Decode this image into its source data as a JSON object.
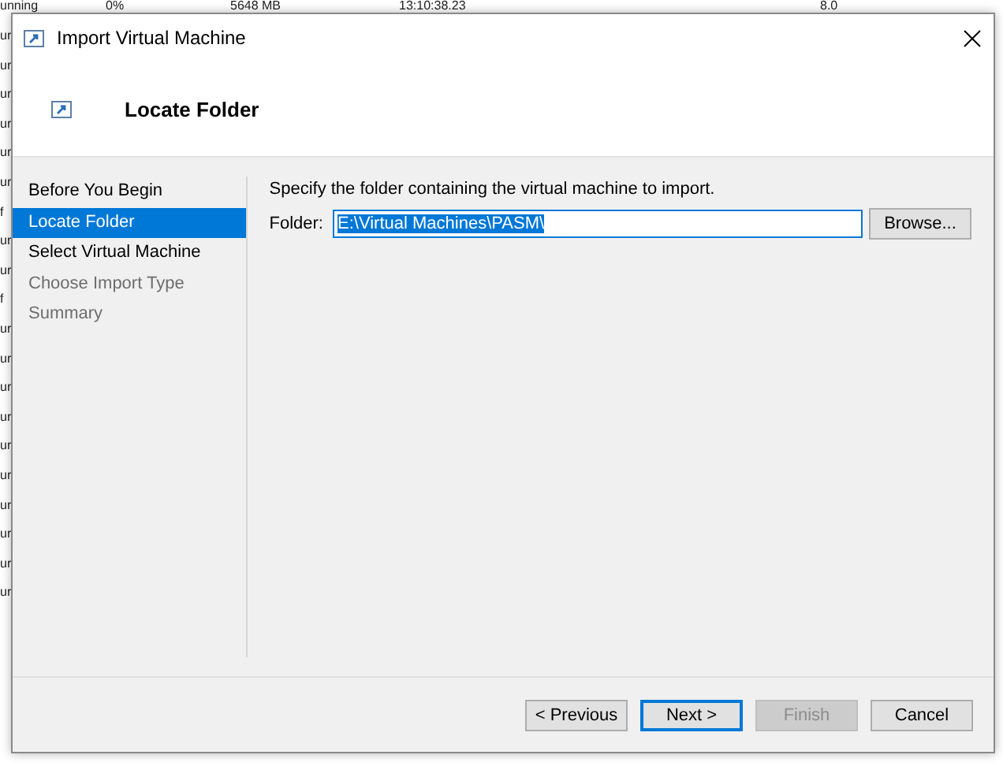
{
  "background_window": {
    "row": [
      "unning",
      "0%",
      "5648 MB",
      "13:10:38.23",
      "8.0"
    ],
    "left_column": [
      "ur",
      "ur",
      "ur",
      "ur",
      "ur",
      "ur",
      "f",
      "ur",
      "ur",
      "f",
      "ur",
      "ur",
      "ur",
      "ur",
      "ur",
      "ur",
      "ur",
      "ur",
      "ur",
      "ur"
    ]
  },
  "dialog": {
    "title": "Import Virtual Machine",
    "heading": "Locate Folder",
    "steps": [
      {
        "label": "Before You Begin",
        "selected": false,
        "disabled": false
      },
      {
        "label": "Locate Folder",
        "selected": true,
        "disabled": false
      },
      {
        "label": "Select Virtual Machine",
        "selected": false,
        "disabled": false
      },
      {
        "label": "Choose Import Type",
        "selected": false,
        "disabled": true
      },
      {
        "label": "Summary",
        "selected": false,
        "disabled": true
      }
    ],
    "instruction": "Specify the folder containing the virtual machine to import.",
    "folder": {
      "label": "Folder:",
      "value": "E:\\Virtual Machines\\PASM\\",
      "text_selected": true
    },
    "browse": "Browse...",
    "buttons": [
      {
        "label": "< Previous",
        "disabled": false,
        "default": false
      },
      {
        "label": "Next >",
        "disabled": false,
        "default": true
      },
      {
        "label": "Finish",
        "disabled": true,
        "default": false
      },
      {
        "label": "Cancel",
        "disabled": false,
        "default": false
      }
    ]
  }
}
